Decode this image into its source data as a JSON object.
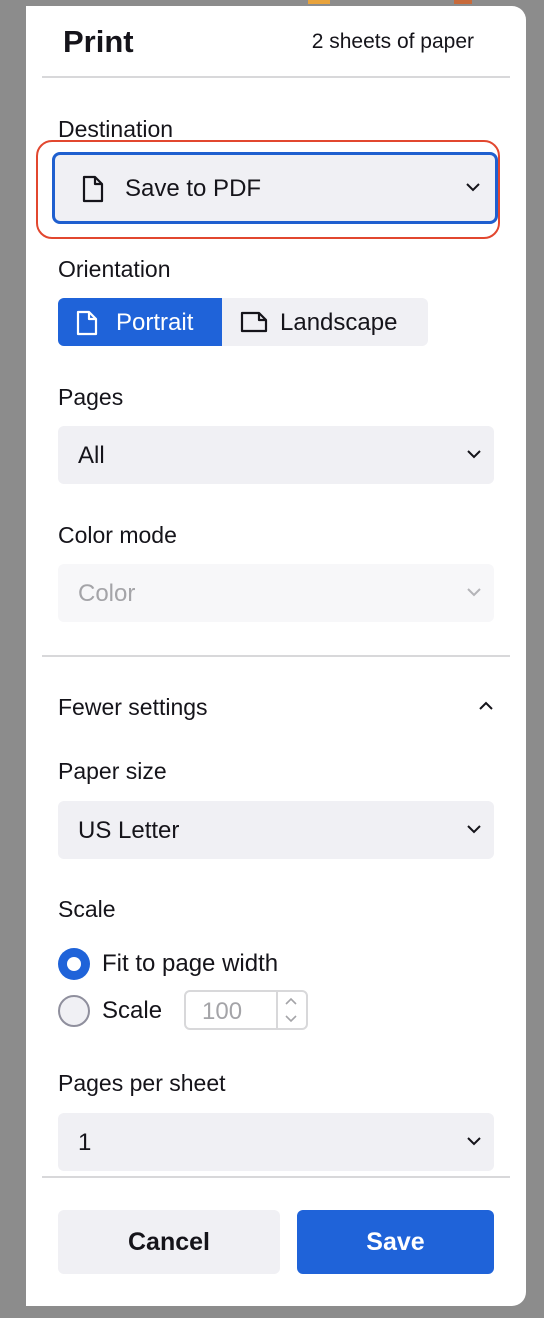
{
  "header": {
    "title": "Print",
    "sheets": "2 sheets of paper"
  },
  "destination": {
    "label": "Destination",
    "value": "Save to PDF"
  },
  "orientation": {
    "label": "Orientation",
    "options": [
      "Portrait",
      "Landscape"
    ],
    "selected": "Portrait"
  },
  "pages": {
    "label": "Pages",
    "value": "All"
  },
  "color_mode": {
    "label": "Color mode",
    "value": "Color",
    "disabled": true
  },
  "more_settings": {
    "label": "Fewer settings",
    "expanded": true
  },
  "paper_size": {
    "label": "Paper size",
    "value": "US Letter"
  },
  "scale": {
    "label": "Scale",
    "options": [
      "Fit to page width",
      "Scale"
    ],
    "selected": "Fit to page width",
    "value": "100"
  },
  "pages_per_sheet": {
    "label": "Pages per sheet",
    "value": "1"
  },
  "footer": {
    "cancel": "Cancel",
    "save": "Save"
  },
  "colors": {
    "accent": "#1f63d9",
    "focus_ring": "#e2472f",
    "field_bg": "#f0f0f4"
  }
}
